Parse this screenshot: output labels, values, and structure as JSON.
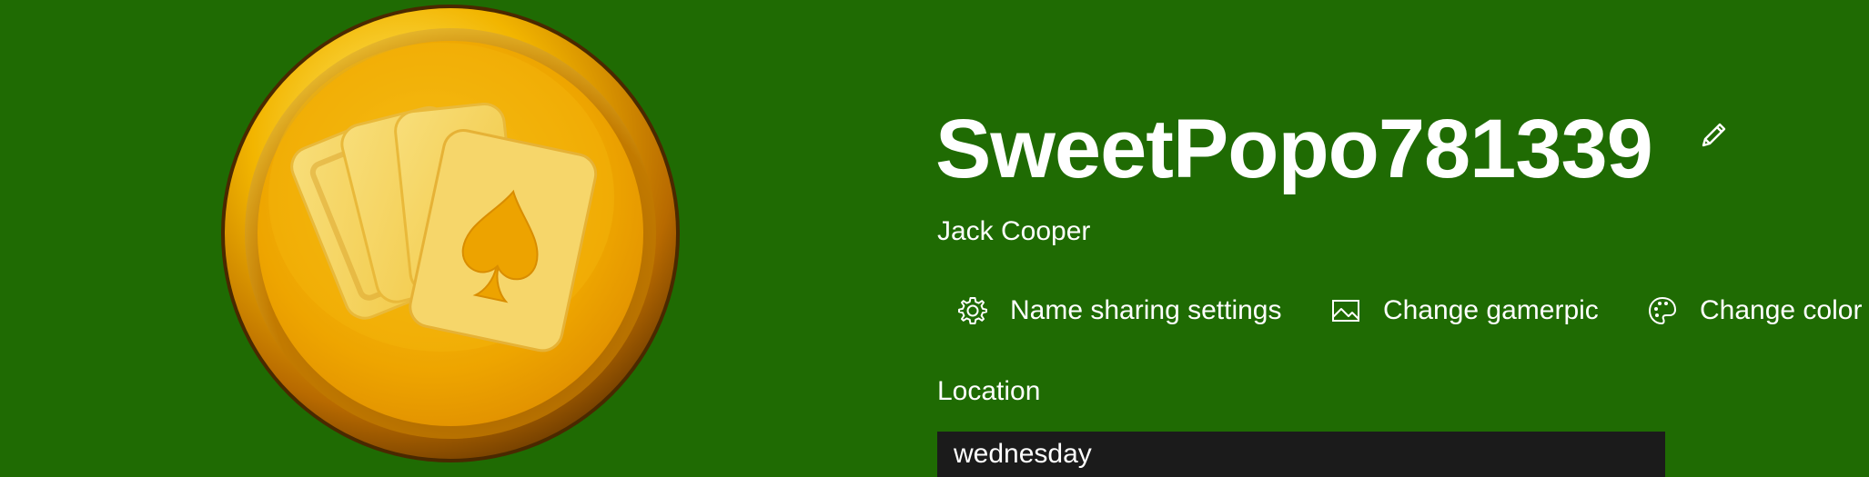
{
  "profile": {
    "gamertag": "SweetPopo781339",
    "real_name": "Jack Cooper",
    "gamerpic_icon": "playing-cards-spade-coin-icon"
  },
  "actions": {
    "name_sharing": {
      "label": "Name sharing settings",
      "icon": "gear-icon"
    },
    "change_gamerpic": {
      "label": "Change gamerpic",
      "icon": "image-icon"
    },
    "change_color": {
      "label": "Change color",
      "icon": "palette-icon"
    }
  },
  "location": {
    "label": "Location",
    "value": "wednesday"
  },
  "colors": {
    "background": "#1f6b03",
    "input_background": "#1b1b1b",
    "gold": "#f0a800",
    "text": "#ffffff"
  }
}
